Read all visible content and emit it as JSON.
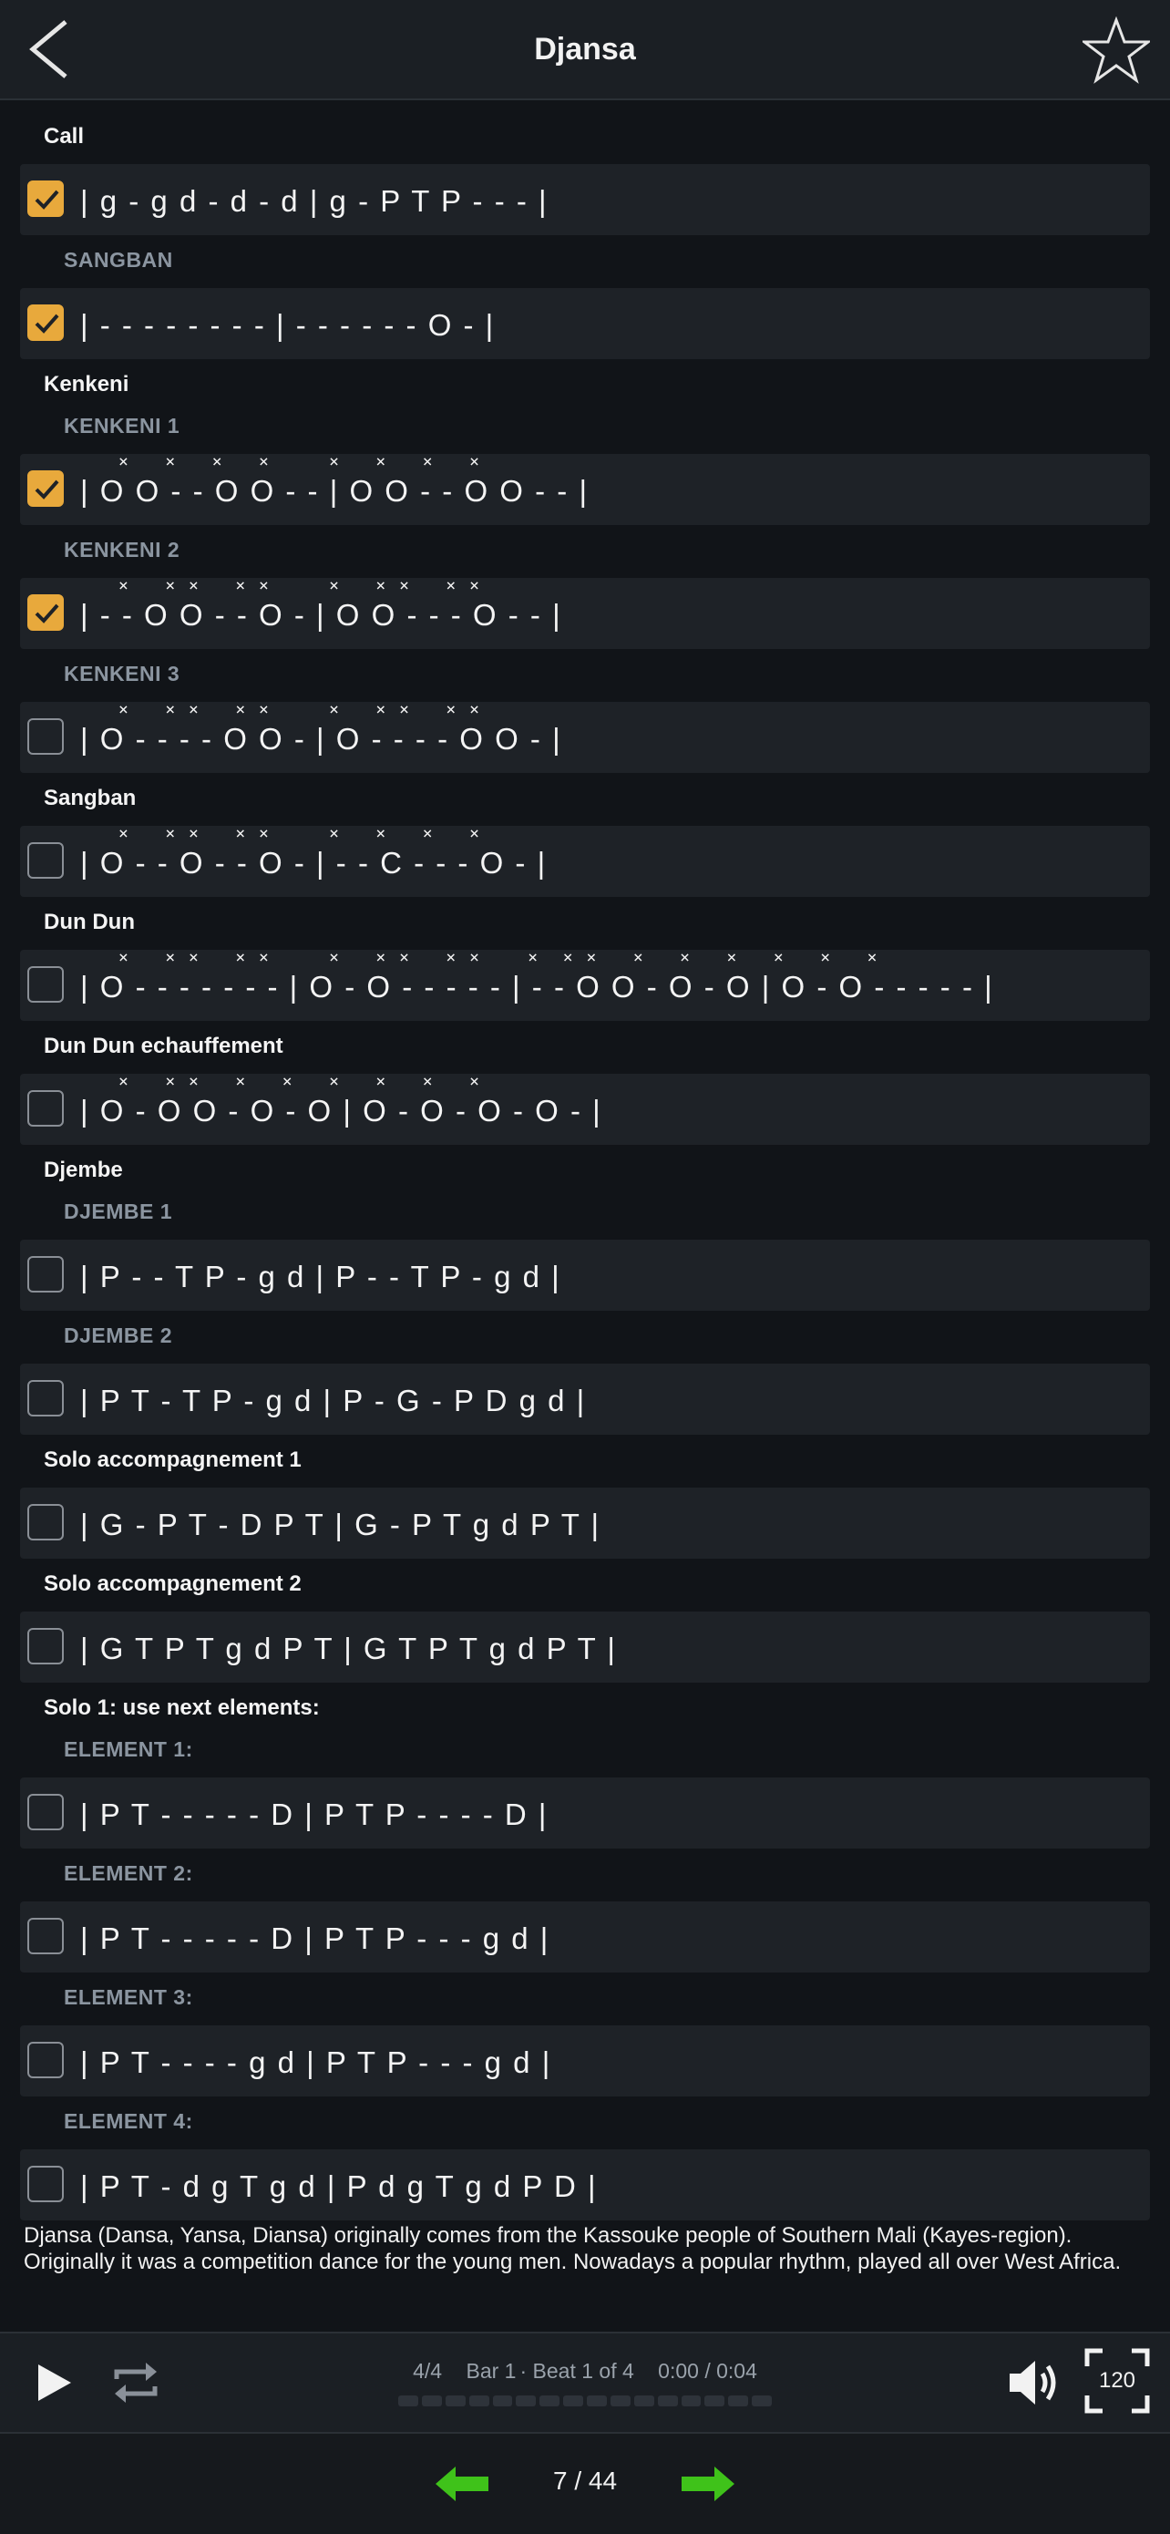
{
  "header": {
    "title": "Djansa"
  },
  "sections": {
    "call": "Call",
    "kenkeni": "Kenkeni",
    "sangban": "Sangban",
    "dundun": "Dun Dun",
    "dundun_warm": "Dun Dun echauffement",
    "djembe": "Djembe",
    "solo_acc1": "Solo accompagnement 1",
    "solo_acc2": "Solo accompagnement 2",
    "solo1": "Solo 1: use next elements:"
  },
  "subsections": {
    "sangban": "SANGBAN",
    "kenkeni1": "KENKENI 1",
    "kenkeni2": "KENKENI 2",
    "kenkeni3": "KENKENI 3",
    "djembe1": "DJEMBE 1",
    "djembe2": "DJEMBE 2",
    "element1": "ELEMENT 1:",
    "element2": "ELEMENT 2:",
    "element3": "ELEMENT 3:",
    "element4": "ELEMENT 4:"
  },
  "rows": {
    "call": {
      "pattern": "| g - g d - d - d | g - P T P - - - |",
      "checked": true
    },
    "call_sangban": {
      "pattern": "| - - - - - - - - | - - - - - - O - |",
      "checked": true
    },
    "kenkeni1": {
      "pattern": "| O O - - O O - - | O O - - O O - - |",
      "marks": "×   ×   ×   ×     ×   ×   ×   ×",
      "checked": true
    },
    "kenkeni2": {
      "pattern": "| - - O O - - O - | O O - - - O - - |",
      "marks": "×   × ×   × ×     ×   × ×   × ×",
      "checked": true
    },
    "kenkeni3": {
      "pattern": "| O - - - - O O - | O - - - - O O - |",
      "marks": "×   × ×   × ×     ×   × ×   × ×",
      "checked": false
    },
    "sangban": {
      "pattern": "| O - - O - - O - | - - C - - - O - |",
      "marks": "×   × ×   × ×     ×   ×   ×   ×",
      "checked": false
    },
    "dundun": {
      "pattern": "| O - - - - - - - | O - O - - - - - | - - O O - O - O | O - O - - - - - |",
      "marks": "×   × ×   × ×     ×   × ×   × ×    ×  × ×   ×   ×   ×   ×   ×   ×",
      "checked": false
    },
    "dundun_warm": {
      "pattern": "| O - O O - O - O | O - O - O - O - |",
      "marks": "×   × ×   ×   ×   ×   ×   ×   ×",
      "checked": false
    },
    "djembe1": {
      "pattern": "| P - - T P - g d | P - - T P - g d |",
      "checked": false
    },
    "djembe2": {
      "pattern": "| P T - T P - g d | P - G - P D g d |",
      "checked": false
    },
    "solo_acc1": {
      "pattern": "| G - P T - D P T | G - P T g d P T |",
      "checked": false
    },
    "solo_acc2": {
      "pattern": "| G T P T g d P T | G T P T g d P T |",
      "checked": false
    },
    "element1": {
      "pattern": "| P T - - - - - D | P T P - - - - D |",
      "checked": false
    },
    "element2": {
      "pattern": "| P T - - - - - D | P T P - - - g d |",
      "checked": false
    },
    "element3": {
      "pattern": "| P T - - - - g d | P T P - - - g d |",
      "checked": false
    },
    "element4": {
      "pattern": "| P T - d g T g d | P d g T g d P D |",
      "checked": false
    }
  },
  "description": "Djansa (Dansa, Yansa, Diansa) originally comes from the Kassouke people of Southern Mali (Kayes-region). Originally it was a competition dance for the young men. Nowadays a popular rhythm, played all over West Africa.",
  "player": {
    "time_signature": "4/4",
    "bar": "Bar 1",
    "beat": "· Beat 1 of 4",
    "time": "0:00 / 0:04",
    "tempo": "120",
    "progress_segments": 16
  },
  "nav": {
    "counter": "7 / 44"
  },
  "colors": {
    "accent": "#e8a93c",
    "open_tone_orange": "#f08a1c",
    "open_tone_green": "#3ec03e",
    "nav_arrow": "#3fc21a"
  }
}
